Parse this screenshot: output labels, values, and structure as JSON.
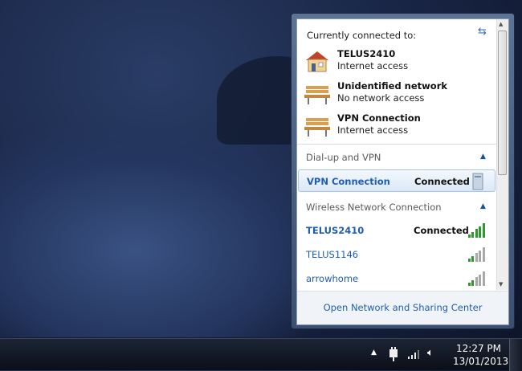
{
  "popup": {
    "header": "Currently connected to:",
    "connected": [
      {
        "name": "TELUS2410",
        "status": "Internet access",
        "icon": "home-network-icon"
      },
      {
        "name": "Unidentified network",
        "status": "No network access",
        "icon": "public-network-bench-icon"
      },
      {
        "name": "VPN Connection",
        "status": "Internet access",
        "icon": "public-network-bench-icon"
      }
    ],
    "sections": {
      "dialup": {
        "title": "Dial-up and VPN",
        "rows": [
          {
            "name": "VPN Connection",
            "status": "Connected"
          }
        ]
      },
      "wireless": {
        "title": "Wireless Network Connection",
        "rows": [
          {
            "name": "TELUS2410",
            "status": "Connected",
            "signal_bars": 5
          },
          {
            "name": "TELUS1146",
            "status": "",
            "signal_bars": 2
          },
          {
            "name": "arrowhome",
            "status": "",
            "signal_bars": 2
          }
        ]
      }
    },
    "footer_link": "Open Network and Sharing Center"
  },
  "taskbar": {
    "time": "12:27 PM",
    "date": "13/01/2013"
  },
  "colors": {
    "link": "#1f5fae",
    "signal_on": "#2e9a2e",
    "signal_off": "#a8a8a8"
  }
}
